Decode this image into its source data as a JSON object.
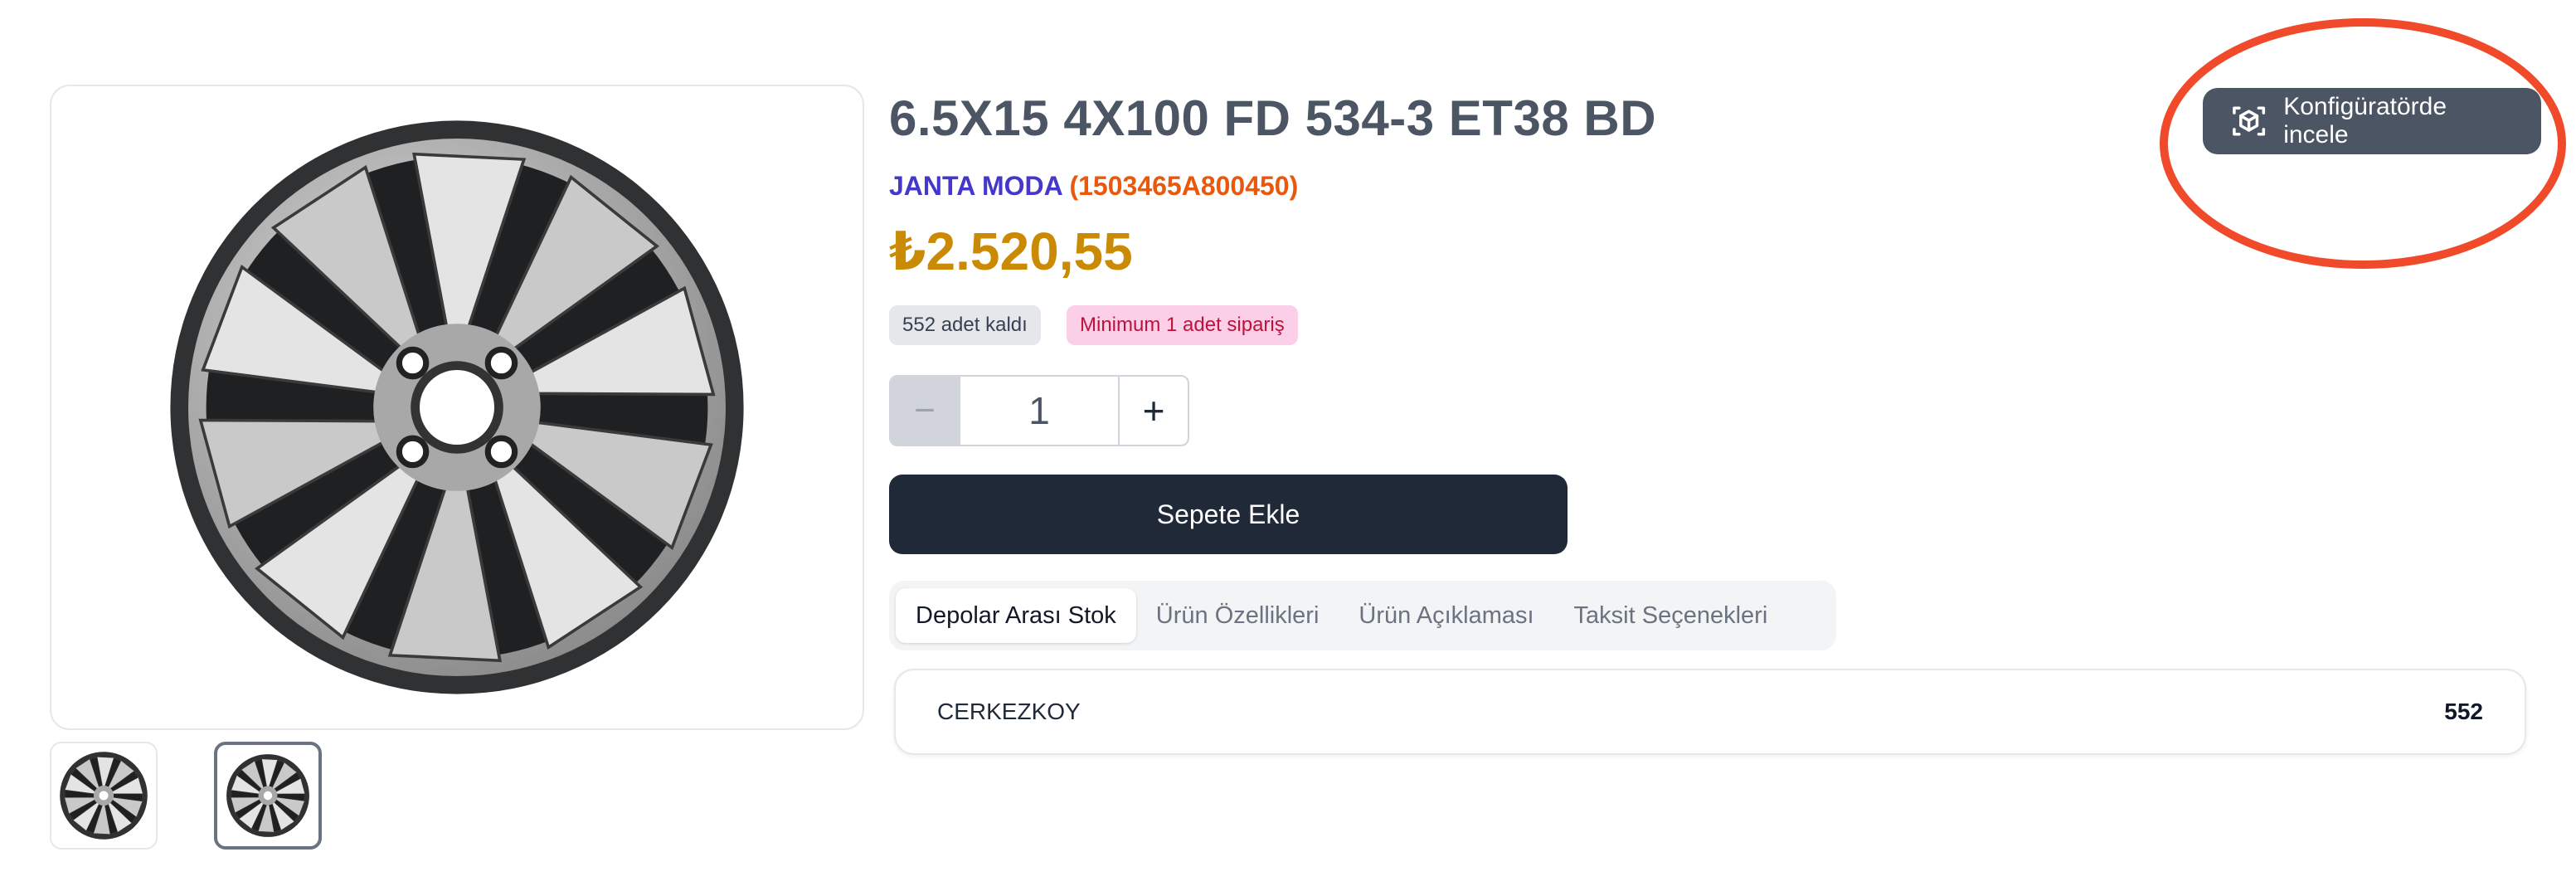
{
  "product": {
    "title": "6.5X15 4X100 FD 534-3 ET38 BD",
    "brand": "JANTA MODA",
    "sku": "(1503465A800450)",
    "price": "₺2.520,55",
    "stock_badge": "552 adet kaldı",
    "min_badge": "Minimum 1 adet sipariş"
  },
  "quantity": {
    "minus_label": "−",
    "value": "1",
    "plus_label": "+"
  },
  "add_to_cart_label": "Sepete Ekle",
  "tabs": [
    {
      "label": "Depolar Arası Stok",
      "active": true
    },
    {
      "label": "Ürün Özellikleri",
      "active": false
    },
    {
      "label": "Ürün Açıklaması",
      "active": false
    },
    {
      "label": "Taksit Seçenekleri",
      "active": false
    }
  ],
  "warehouse": {
    "name": "CERKEZKOY",
    "count": "552"
  },
  "configurator_button": {
    "label": "Konfigüratörde incele",
    "icon": "cube-icon"
  },
  "annotation": {
    "color": "#f04a2a"
  },
  "colors": {
    "brand": "#4338ca",
    "sku": "#ea580c",
    "price": "#ca8a04",
    "primary_button": "#1f2937",
    "config_button": "#4b5563"
  }
}
